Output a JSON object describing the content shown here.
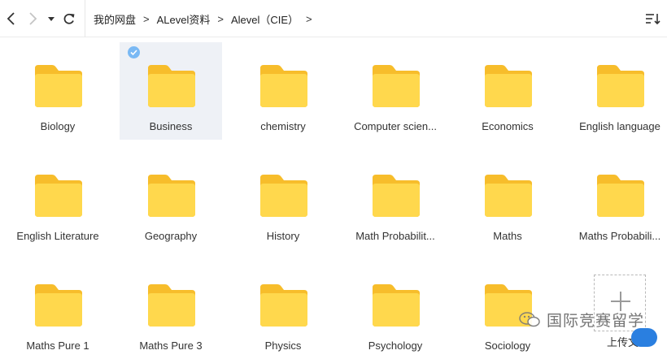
{
  "nav": {
    "breadcrumbs": [
      "我的网盘",
      "ALevel资料",
      "Alevel（CIE）"
    ],
    "separator": ">"
  },
  "folders": [
    "Biology",
    "Business",
    "chemistry",
    "Computer scien...",
    "Economics",
    "English language",
    "English Literature",
    "Geography",
    "History",
    "Math Probabilit...",
    "Maths",
    "Maths Probabili...",
    "Maths Pure 1",
    "Maths Pure 3",
    "Physics",
    "Psychology",
    "Sociology"
  ],
  "selected_folder_index": 1,
  "upload": {
    "label": "上传文"
  },
  "watermark": {
    "text": "国际竞赛留学"
  },
  "colors": {
    "folder_back": "#f7bd2b",
    "folder_front": "#ffd84d",
    "selected_bg": "#eef1f6",
    "check": "#7ab9f4"
  }
}
